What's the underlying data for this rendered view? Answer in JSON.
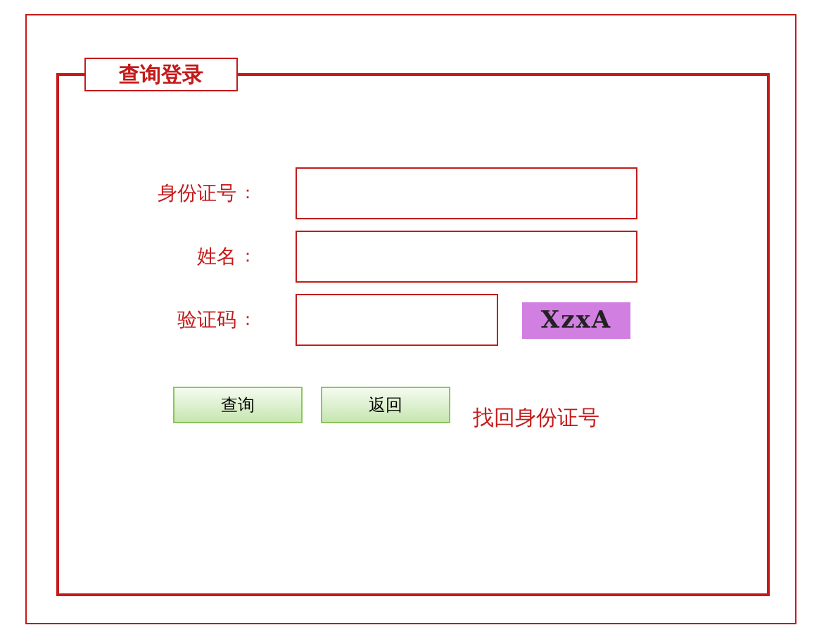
{
  "panel": {
    "title": "查询登录"
  },
  "fields": [
    {
      "label": "身份证号",
      "colon": "：",
      "kind": "wide"
    },
    {
      "label": "姓名",
      "colon": "：",
      "kind": "wide"
    },
    {
      "label": "验证码",
      "colon": "：",
      "kind": "captcha",
      "captcha": "XzxA"
    }
  ],
  "buttons": [
    "查询",
    "返回"
  ],
  "link": "找回身份证号"
}
